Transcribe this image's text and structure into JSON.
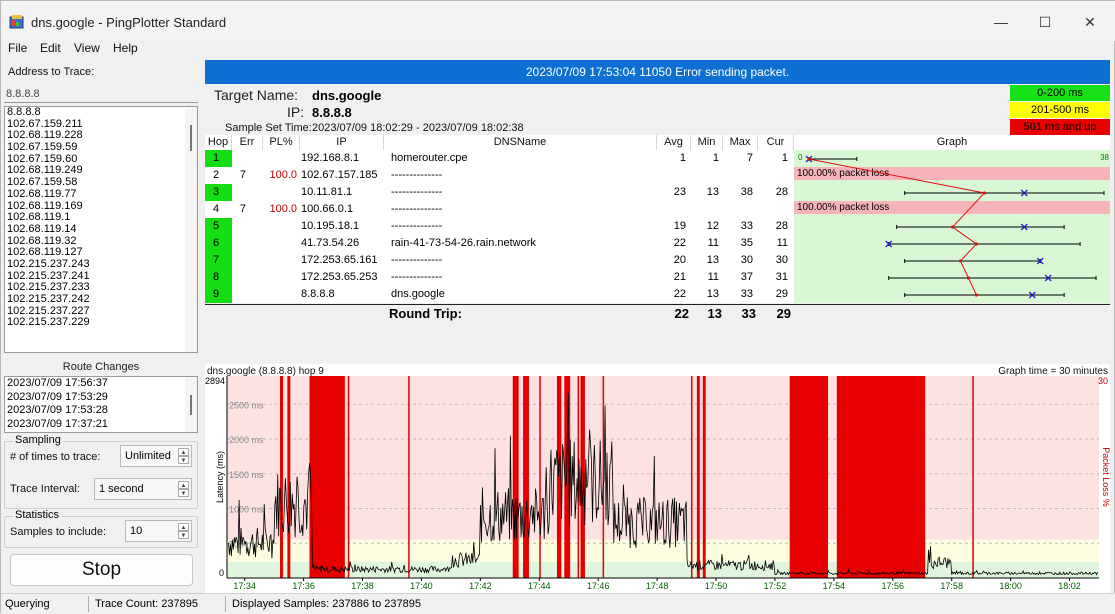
{
  "window": {
    "title": "dns.google - PingPlotter Standard"
  },
  "menu": [
    "File",
    "Edit",
    "View",
    "Help"
  ],
  "left": {
    "address_label": "Address to Trace:",
    "address_value": "8.8.8.8",
    "addresses": [
      "8.8.8.8",
      "102.67.159.211",
      "102.68.119.228",
      "102.67.159.59",
      "102.67.159.60",
      "102.68.119.249",
      "102.67.159.58",
      "102.68.119.77",
      "102.68.119.169",
      "102.68.119.1",
      "102.68.119.14",
      "102.68.119.32",
      "102.68.119.127",
      "102.215.237.243",
      "102.215.237.241",
      "102.215.237.233",
      "102.215.237.242",
      "102.215.237.227",
      "102.215.237.229"
    ],
    "route_changes_label": "Route Changes",
    "route_changes": [
      "2023/07/09 17:56:37",
      "2023/07/09 17:53:29",
      "2023/07/09 17:53:28",
      "2023/07/09 17:37:21"
    ],
    "sampling_label": "Sampling",
    "times_label": "# of times to trace:",
    "times_value": "Unlimited",
    "interval_label": "Trace Interval:",
    "interval_value": "1 second",
    "statistics_label": "Statistics",
    "samples_label": "Samples to include:",
    "samples_value": "10",
    "stop_label": "Stop"
  },
  "banner": "2023/07/09 17:53:04 11050 Error sending packet.",
  "target": {
    "name_label": "Target Name:",
    "name": "dns.google",
    "ip_label": "IP:",
    "ip": "8.8.8.8",
    "sample_label": "Sample Set Time:",
    "sample_range": "2023/07/09 18:02:29 - 2023/07/09 18:02:38"
  },
  "legend": [
    {
      "label": "0-200 ms",
      "color": "#18e018",
      "text": "#000000"
    },
    {
      "label": "201-500 ms",
      "color": "#ffff00",
      "text": "#000000"
    },
    {
      "label": "501 ms and up",
      "color": "#e60000",
      "text": "#000000"
    }
  ],
  "columns": {
    "hop": "Hop",
    "err": "Err",
    "pl": "PL%",
    "ip": "IP",
    "dns": "DNSName",
    "avg": "Avg",
    "min": "Min",
    "max": "Max",
    "cur": "Cur",
    "graph": "Graph"
  },
  "graph_scale": {
    "min": "0",
    "max": "38"
  },
  "hops": [
    {
      "hop": "1",
      "err": "",
      "pl": "",
      "ip": "192.168.8.1",
      "dns": "homerouter.cpe",
      "avg": "1",
      "min": "1",
      "max": "7",
      "cur": "1",
      "green": true,
      "loss": "",
      "ms_avg": 1,
      "ms_min": 1,
      "ms_max": 7
    },
    {
      "hop": "2",
      "err": "7",
      "pl": "100.0",
      "ip": "102.67.157.185",
      "dns": "--------------",
      "avg": "",
      "min": "",
      "max": "",
      "cur": "",
      "green": false,
      "loss": "100.00% packet loss"
    },
    {
      "hop": "3",
      "err": "",
      "pl": "",
      "ip": "10.11.81.1",
      "dns": "--------------",
      "avg": "23",
      "min": "13",
      "max": "38",
      "cur": "28",
      "green": true,
      "loss": "",
      "ms_avg": 23,
      "ms_min": 13,
      "ms_max": 38
    },
    {
      "hop": "4",
      "err": "7",
      "pl": "100.0",
      "ip": "100.66.0.1",
      "dns": "--------------",
      "avg": "",
      "min": "",
      "max": "",
      "cur": "",
      "green": false,
      "loss": "100.00% packet loss"
    },
    {
      "hop": "5",
      "err": "",
      "pl": "",
      "ip": "10.195.18.1",
      "dns": "--------------",
      "avg": "19",
      "min": "12",
      "max": "33",
      "cur": "28",
      "green": true,
      "loss": "",
      "ms_avg": 19,
      "ms_min": 12,
      "ms_max": 33
    },
    {
      "hop": "6",
      "err": "",
      "pl": "",
      "ip": "41.73.54.26",
      "dns": "rain-41-73-54-26.rain.network",
      "avg": "22",
      "min": "11",
      "max": "35",
      "cur": "11",
      "green": true,
      "loss": "",
      "ms_avg": 22,
      "ms_min": 11,
      "ms_max": 35
    },
    {
      "hop": "7",
      "err": "",
      "pl": "",
      "ip": "172.253.65.161",
      "dns": "--------------",
      "avg": "20",
      "min": "13",
      "max": "30",
      "cur": "30",
      "green": true,
      "loss": "",
      "ms_avg": 20,
      "ms_min": 13,
      "ms_max": 30
    },
    {
      "hop": "8",
      "err": "",
      "pl": "",
      "ip": "172.253.65.253",
      "dns": "--------------",
      "avg": "21",
      "min": "11",
      "max": "37",
      "cur": "31",
      "green": true,
      "loss": "",
      "ms_avg": 21,
      "ms_min": 11,
      "ms_max": 37
    },
    {
      "hop": "9",
      "err": "",
      "pl": "",
      "ip": "8.8.8.8",
      "dns": "dns.google",
      "avg": "22",
      "min": "13",
      "max": "33",
      "cur": "29",
      "green": true,
      "loss": "",
      "ms_avg": 22,
      "ms_min": 13,
      "ms_max": 33
    }
  ],
  "round_trip": {
    "label": "Round Trip:",
    "avg": "22",
    "min": "13",
    "max": "33",
    "cur": "29"
  },
  "timeline": {
    "title": "dns.google (8.8.8.8) hop 9",
    "graph_time": "Graph time = 30 minutes",
    "ymax_label": "2894",
    "ymin_label": "0",
    "y_axis_label": "Latency (ms)",
    "right_axis_label": "Packet Loss %",
    "right_max_label": "30",
    "gridlines": [
      "2500 ms",
      "2000 ms",
      "1500 ms",
      "1000 ms",
      "500 ms"
    ],
    "time_labels": [
      "17:34",
      "17:36",
      "17:38",
      "17:40",
      "17:42",
      "17:44",
      "17:46",
      "17:48",
      "17:50",
      "17:52",
      "17:54",
      "17:56",
      "17:58",
      "18:00",
      "18:02"
    ],
    "time_start_min": 33.4,
    "time_end_min": 63.0,
    "loss_blocks": [
      [
        35.2,
        35.3
      ],
      [
        35.45,
        35.55
      ],
      [
        36.2,
        37.4
      ],
      [
        37.5,
        37.55
      ],
      [
        39.55,
        39.6
      ],
      [
        43.1,
        43.3
      ],
      [
        43.45,
        43.65
      ],
      [
        44.0,
        44.05
      ],
      [
        44.6,
        44.75
      ],
      [
        44.85,
        45.05
      ],
      [
        45.3,
        45.35
      ],
      [
        45.4,
        45.55
      ],
      [
        46.15,
        46.2
      ],
      [
        49.15,
        49.2
      ],
      [
        49.35,
        49.45
      ],
      [
        49.55,
        49.65
      ],
      [
        52.5,
        53.8
      ],
      [
        54.1,
        57.1
      ],
      [
        58.7,
        58.75
      ]
    ]
  },
  "status": {
    "state": "Querying",
    "trace_count": "Trace Count: 237895",
    "displayed": "Displayed Samples: 237886 to 237895"
  }
}
